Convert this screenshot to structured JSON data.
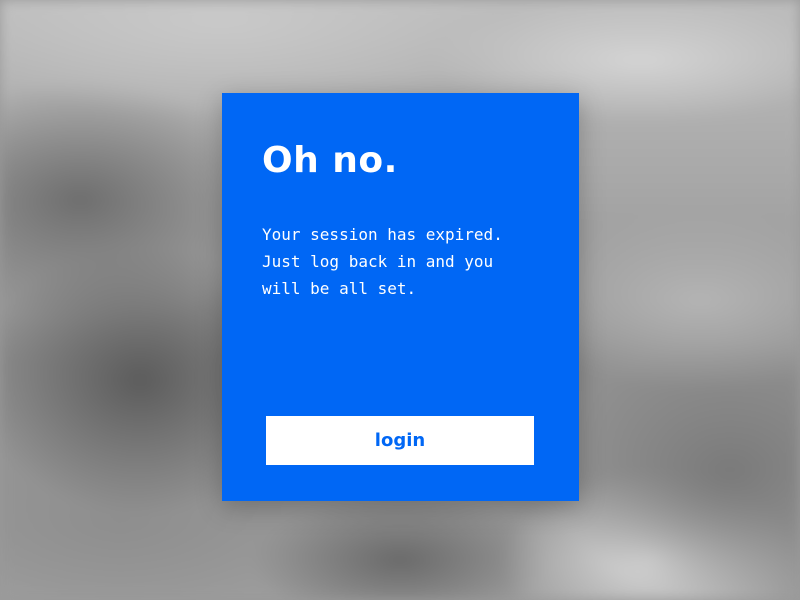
{
  "dialog": {
    "title": "Oh no.",
    "message_lines": [
      "Your session has expired.",
      "Just log back in and you",
      "will be all set."
    ],
    "login_label": "login"
  },
  "colors": {
    "card_background": "#0067f5",
    "button_background": "#ffffff",
    "button_text": "#0067f5",
    "text": "#ffffff"
  },
  "icons": {
    "background": "blurred-landscape-photo"
  }
}
